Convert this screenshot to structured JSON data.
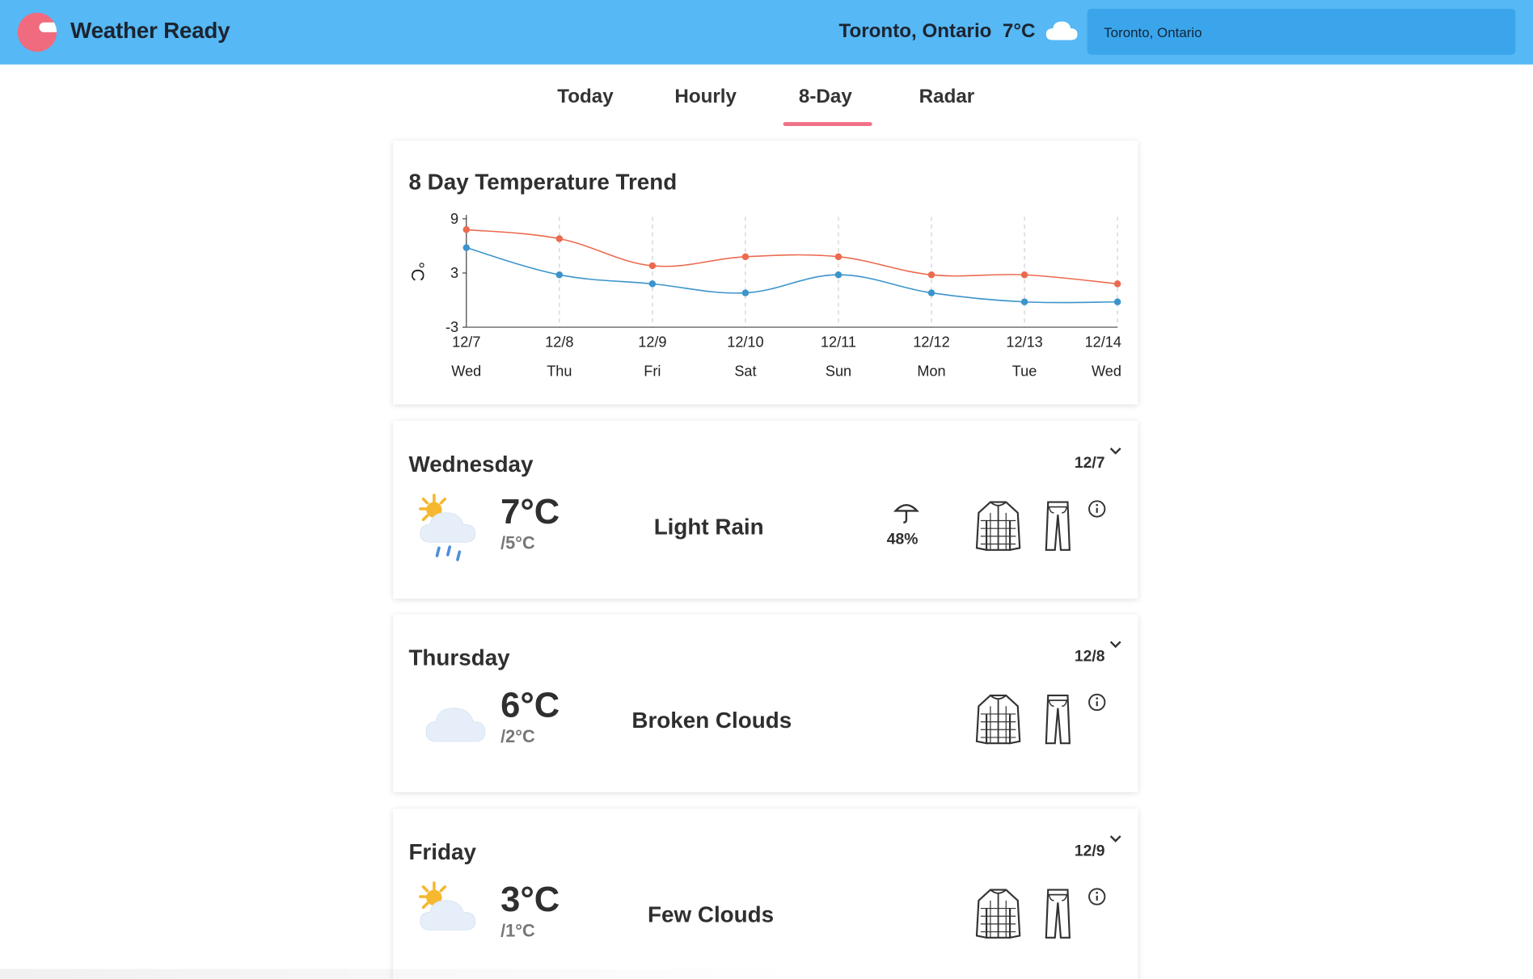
{
  "header": {
    "app_title": "Weather Ready",
    "location_temp": "Toronto, Ontario  7°C",
    "search_value": "Toronto, Ontario",
    "bg_color": "#56b8f5",
    "logo_color": "#f06b7e",
    "cloud_icon": "cloud-icon"
  },
  "tabs": [
    {
      "label": "Today",
      "active": false
    },
    {
      "label": "Hourly",
      "active": false
    },
    {
      "label": "8-Day",
      "active": true
    },
    {
      "label": "Radar",
      "active": false
    }
  ],
  "accent_color": "#f07186",
  "chart_data": {
    "type": "line",
    "title": "8 Day Temperature Trend",
    "ylabel": "°C",
    "xlabel": "",
    "ylim": [
      -3,
      9
    ],
    "yticks": [
      9,
      3,
      -3
    ],
    "categories": [
      "12/7",
      "12/8",
      "12/9",
      "12/10",
      "12/11",
      "12/12",
      "12/13",
      "12/14"
    ],
    "weekdays": [
      "Wed",
      "Thu",
      "Fri",
      "Sat",
      "Sun",
      "Mon",
      "Tue",
      "Wed"
    ],
    "grid": "vertical dashed",
    "series": [
      {
        "color": "#ec6a4e",
        "values": [
          7.8,
          6.8,
          3.8,
          4.8,
          4.8,
          2.8,
          2.8,
          1.8
        ]
      },
      {
        "color": "#3b94cc",
        "values": [
          5.8,
          2.8,
          1.8,
          0.8,
          2.8,
          0.8,
          -0.2,
          -0.2
        ]
      }
    ]
  },
  "days": [
    {
      "name": "Wednesday",
      "date": "12/7",
      "high": "7°C",
      "low": "/5°C",
      "condition": "Light Rain",
      "icon": "sun-rain-cloud-icon",
      "precip": "48%",
      "show_precip": true
    },
    {
      "name": "Thursday",
      "date": "12/8",
      "high": "6°C",
      "low": "/2°C",
      "condition": "Broken Clouds",
      "icon": "cloud-icon",
      "precip": "",
      "show_precip": false
    },
    {
      "name": "Friday",
      "date": "12/9",
      "high": "3°C",
      "low": "/1°C",
      "condition": "Few Clouds",
      "icon": "sun-cloud-icon",
      "precip": "",
      "show_precip": false
    }
  ]
}
